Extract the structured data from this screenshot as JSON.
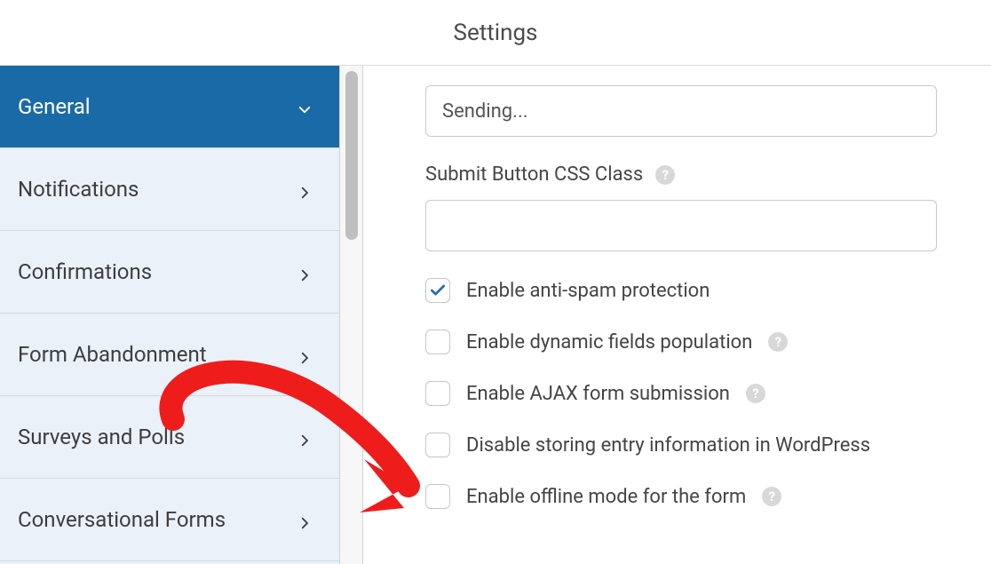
{
  "header": {
    "title": "Settings"
  },
  "sidebar": {
    "items": [
      {
        "label": "General",
        "active": true
      },
      {
        "label": "Notifications"
      },
      {
        "label": "Confirmations"
      },
      {
        "label": "Form Abandonment"
      },
      {
        "label": "Surveys and Polls"
      },
      {
        "label": "Conversational Forms"
      }
    ]
  },
  "main": {
    "sending_value": "Sending...",
    "css_class_label": "Submit Button CSS Class",
    "css_class_value": "",
    "options": [
      {
        "label": "Enable anti-spam protection",
        "checked": true,
        "help": false
      },
      {
        "label": "Enable dynamic fields population",
        "checked": false,
        "help": true
      },
      {
        "label": "Enable AJAX form submission",
        "checked": false,
        "help": true
      },
      {
        "label": "Disable storing entry information in WordPress",
        "checked": false,
        "help": false
      },
      {
        "label": "Enable offline mode for the form",
        "checked": false,
        "help": true
      }
    ]
  }
}
